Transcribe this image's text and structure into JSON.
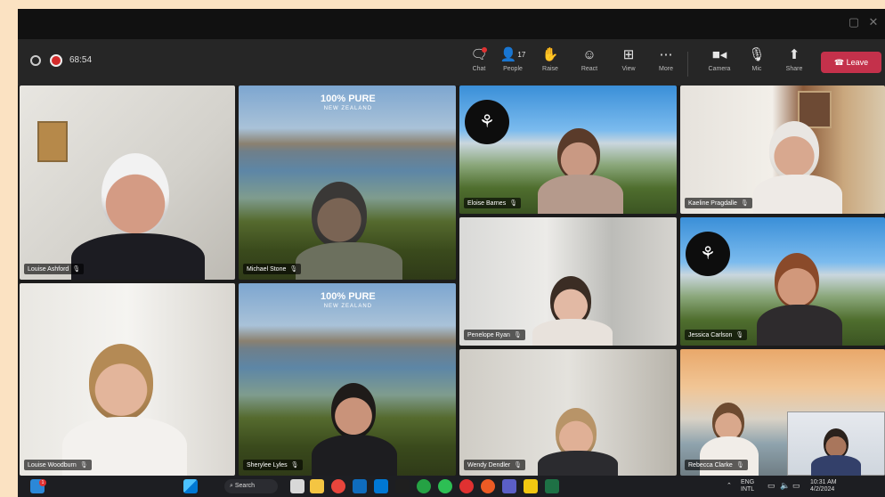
{
  "meeting": {
    "timer": "68:54"
  },
  "toolbar": {
    "buttons": [
      {
        "label": "Chat",
        "icon": "chat-icon"
      },
      {
        "label": "People",
        "icon": "people-icon",
        "count": "17"
      },
      {
        "label": "Raise",
        "icon": "raise-hand-icon"
      },
      {
        "label": "React",
        "icon": "react-icon"
      },
      {
        "label": "View",
        "icon": "view-icon"
      },
      {
        "label": "More",
        "icon": "more-icon"
      },
      {
        "label": "Camera",
        "icon": "camera-icon"
      },
      {
        "label": "Mic",
        "icon": "mic-icon"
      },
      {
        "label": "Share",
        "icon": "share-icon"
      }
    ],
    "leave_label": "Leave"
  },
  "participants": [
    {
      "name": "Louise Ashford"
    },
    {
      "name": "Michael Stone"
    },
    {
      "name": "Eloise Barnes"
    },
    {
      "name": "Kaeline Pragdalle"
    },
    {
      "name": "Penelope Ryan"
    },
    {
      "name": "Jessica Carlson"
    },
    {
      "name": "Louise Woodburn"
    },
    {
      "name": "Sherylee Lyles"
    },
    {
      "name": "Wendy Dendler"
    },
    {
      "name": "Rebecca Clarke"
    }
  ],
  "backgrounds": {
    "nz_line1": "100% PURE",
    "nz_line2": "NEW ZEALAND"
  },
  "taskbar": {
    "search_label": "Search",
    "notification_count": "1",
    "lang_line1": "ENG",
    "lang_line2": "INTL",
    "time": "10:31 AM",
    "date": "4/2/2024"
  },
  "colors": {
    "leave": "#c4314b",
    "record": "#d42b2b",
    "toolbar": "#262626"
  }
}
